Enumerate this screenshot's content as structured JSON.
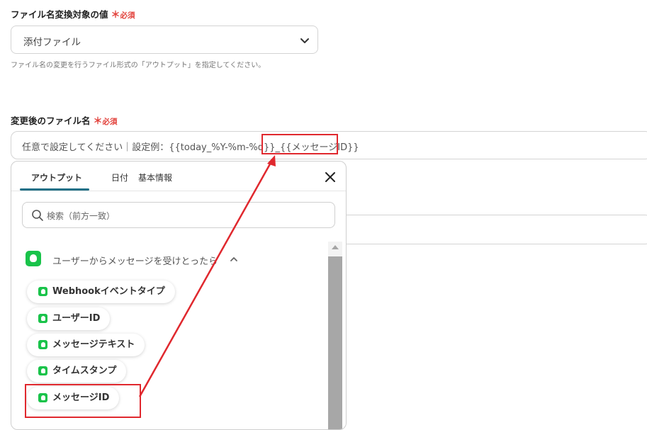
{
  "field1": {
    "label": "ファイル名変換対象の値",
    "required_mark": "＊",
    "required_text": "必須",
    "value": "添付ファイル",
    "help": "ファイル名の変更を行うファイル形式の「アウトプット」を指定してください。"
  },
  "field2": {
    "label": "変更後のファイル名",
    "required_mark": "＊",
    "required_text": "必須",
    "value": "任意で設定してください｜設定例：{{today_%Y-%m-%d}}_{{メッセージID}}"
  },
  "picker": {
    "tabs": [
      "アウトプット",
      "日付",
      "基本情報"
    ],
    "active_tab": "アウトプット",
    "search_placeholder": "検索（前方一致）",
    "section_title": "ユーザーからメッセージを受けとったら",
    "items": [
      "Webhookイベントタイプ",
      "ユーザーID",
      "メッセージテキスト",
      "タイムスタンプ",
      "メッセージID"
    ]
  },
  "colors": {
    "accent": "#1f6f86",
    "required": "#e2403a",
    "app_icon": "#19c34a",
    "highlight": "#e0282e"
  },
  "icons": [
    "chevron-down-icon",
    "close-icon",
    "search-icon",
    "line-app-icon",
    "chevron-up-icon"
  ]
}
